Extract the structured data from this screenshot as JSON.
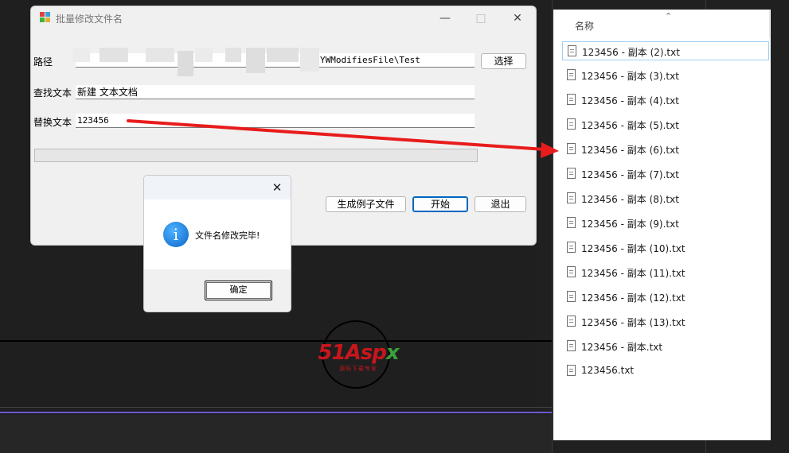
{
  "main_window": {
    "title": "批量修改文件名",
    "path_label": "路径",
    "path_value": "YWModifiesFile\\Test",
    "find_label": "查找文本",
    "find_value": "新建 文本文档",
    "replace_label": "替换文本",
    "replace_value": "123456",
    "select_button": "选择",
    "generate_button": "生成例子文件",
    "start_button": "开始",
    "exit_button": "退出",
    "progress_fraction": 0
  },
  "message_box": {
    "message": "文件名修改完毕!",
    "ok_button": "确定"
  },
  "explorer": {
    "column_name": "名称",
    "files": [
      "123456 - 副本 (2).txt",
      "123456 - 副本 (3).txt",
      "123456 - 副本 (4).txt",
      "123456 - 副本 (5).txt",
      "123456 - 副本 (6).txt",
      "123456 - 副本 (7).txt",
      "123456 - 副本 (8).txt",
      "123456 - 副本 (9).txt",
      "123456 - 副本 (10).txt",
      "123456 - 副本 (11).txt",
      "123456 - 副本 (12).txt",
      "123456 - 副本 (13).txt",
      "123456 - 副本.txt",
      "123456.txt"
    ],
    "selected_index": 0
  },
  "watermark": {
    "logo_text": "51Aspx",
    "tagline": "源码下载专家"
  },
  "colors": {
    "arrow": "#e81c1c",
    "accent": "#0067c0",
    "selection_border": "#9ccff4"
  }
}
